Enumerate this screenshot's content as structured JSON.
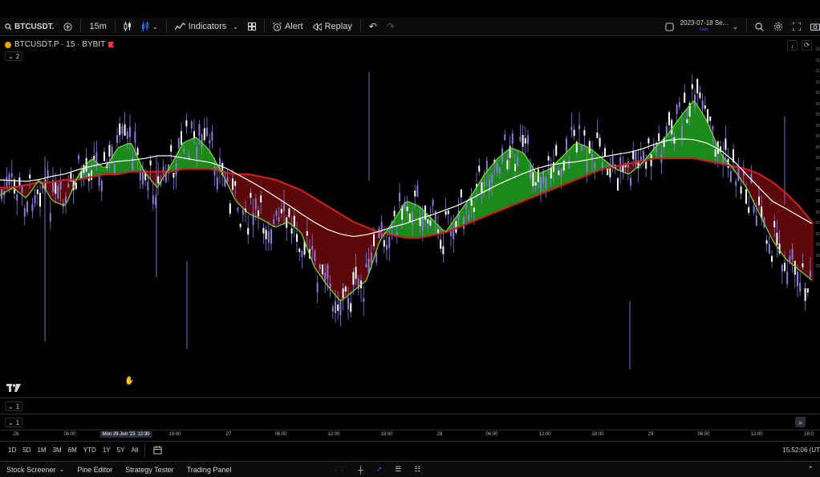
{
  "toolbar": {
    "symbol": "BTCUSDT.",
    "interval": "15m",
    "indicators_label": "Indicators",
    "alert_label": "Alert",
    "replay_label": "Replay",
    "date_label": "2023-07-18 Se...",
    "save_label": "Save"
  },
  "legend": {
    "symbol": "BTCUSDT.P · 15 · BYBIT",
    "count": "2"
  },
  "panes": {
    "pane1_count": "1",
    "pane2_count": "1"
  },
  "time_axis": {
    "ticks": [
      "26",
      "06:00",
      "Mon 26 Jun '23",
      "12:30",
      "18:00",
      "27",
      "06:00",
      "12:00",
      "18:00",
      "28",
      "06:00",
      "12:00",
      "18:00",
      "29",
      "06:00",
      "12:00",
      "18:0"
    ]
  },
  "price_axis": [
    "31",
    "31",
    "31",
    "31",
    "30",
    "30",
    "30",
    "30",
    "30",
    "30",
    "30",
    "30",
    "30",
    "30",
    "30",
    "30",
    "30",
    "30",
    "29",
    "29",
    "29"
  ],
  "range_buttons": [
    "1D",
    "5D",
    "1M",
    "3M",
    "6M",
    "YTD",
    "1Y",
    "5Y",
    "All"
  ],
  "clock": "15:52:06 (UT",
  "bottom": {
    "stock_screener": "Stock Screener",
    "pine_editor": "Pine Editor",
    "strategy_tester": "Strategy Tester",
    "trading_panel": "Trading Panel"
  },
  "colors": {
    "bull": "#1b8a1b",
    "bear": "#5c0808",
    "fast_ma": "#7cd93b",
    "slow_ma": "#c61f1f",
    "trend_ma": "#ffffff",
    "candle": "#8b7bd8"
  },
  "chart_data": {
    "type": "line",
    "series": [
      {
        "values": [
          0.52,
          0.55,
          0.51,
          0.58,
          0.5,
          0.48,
          0.6,
          0.66,
          0.62,
          0.7,
          0.72,
          0.61,
          0.55,
          0.63,
          0.72,
          0.74,
          0.69,
          0.6,
          0.5,
          0.45,
          0.43,
          0.4,
          0.42,
          0.38,
          0.25,
          0.18,
          0.12,
          0.16,
          0.2,
          0.35,
          0.42,
          0.5,
          0.48,
          0.43,
          0.38,
          0.45,
          0.52,
          0.6,
          0.66,
          0.7,
          0.68,
          0.6,
          0.62,
          0.67,
          0.72,
          0.7,
          0.66,
          0.62,
          0.6,
          0.64,
          0.7,
          0.75,
          0.82,
          0.88,
          0.8,
          0.68,
          0.62,
          0.55,
          0.45,
          0.35,
          0.28,
          0.24,
          0.2
        ]
      },
      {
        "values": [
          0.55,
          0.55,
          0.56,
          0.57,
          0.57,
          0.58,
          0.58,
          0.59,
          0.6,
          0.6,
          0.61,
          0.61,
          0.61,
          0.61,
          0.62,
          0.62,
          0.62,
          0.61,
          0.6,
          0.6,
          0.59,
          0.58,
          0.56,
          0.54,
          0.51,
          0.48,
          0.45,
          0.42,
          0.4,
          0.38,
          0.37,
          0.36,
          0.36,
          0.37,
          0.38,
          0.4,
          0.42,
          0.44,
          0.46,
          0.48,
          0.5,
          0.52,
          0.54,
          0.56,
          0.58,
          0.6,
          0.62,
          0.63,
          0.64,
          0.65,
          0.66,
          0.66,
          0.66,
          0.66,
          0.65,
          0.64,
          0.63,
          0.62,
          0.6,
          0.57,
          0.53,
          0.48,
          0.42
        ]
      }
    ]
  }
}
